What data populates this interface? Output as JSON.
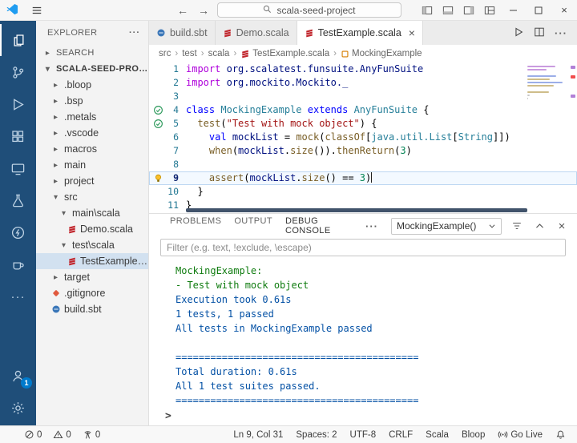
{
  "titlebar": {
    "search_value": "scala-seed-project"
  },
  "activitybar": {
    "account_badge": "1"
  },
  "sidebar": {
    "header": "EXPLORER",
    "tree": [
      {
        "label": "SEARCH",
        "depth": 0,
        "kind": "section",
        "expanded": false
      },
      {
        "label": "SCALA-SEED-PROJECT",
        "depth": 0,
        "kind": "section",
        "expanded": true,
        "bold": true
      },
      {
        "label": ".bloop",
        "depth": 1,
        "kind": "folder",
        "expanded": false
      },
      {
        "label": ".bsp",
        "depth": 1,
        "kind": "folder",
        "expanded": false
      },
      {
        "label": ".metals",
        "depth": 1,
        "kind": "folder",
        "expanded": false
      },
      {
        "label": ".vscode",
        "depth": 1,
        "kind": "folder",
        "expanded": false
      },
      {
        "label": "macros",
        "depth": 1,
        "kind": "folder",
        "expanded": false
      },
      {
        "label": "main",
        "depth": 1,
        "kind": "folder",
        "expanded": false
      },
      {
        "label": "project",
        "depth": 1,
        "kind": "folder",
        "expanded": false
      },
      {
        "label": "src",
        "depth": 1,
        "kind": "folder",
        "expanded": true
      },
      {
        "label": "main\\scala",
        "depth": 2,
        "kind": "folder",
        "expanded": true
      },
      {
        "label": "Demo.scala",
        "depth": 3,
        "kind": "file",
        "icon": "scala"
      },
      {
        "label": "test\\scala",
        "depth": 2,
        "kind": "folder",
        "expanded": true
      },
      {
        "label": "TestExample.scala",
        "depth": 3,
        "kind": "file",
        "icon": "scala",
        "selected": true
      },
      {
        "label": "target",
        "depth": 1,
        "kind": "folder",
        "expanded": false
      },
      {
        "label": ".gitignore",
        "depth": 1,
        "kind": "file",
        "icon": "git"
      },
      {
        "label": "build.sbt",
        "depth": 1,
        "kind": "file",
        "icon": "sbt"
      }
    ]
  },
  "editor_tabs": [
    {
      "label": "build.sbt",
      "icon": "sbt",
      "active": false
    },
    {
      "label": "Demo.scala",
      "icon": "scala",
      "active": false
    },
    {
      "label": "TestExample.scala",
      "icon": "scala",
      "active": true
    }
  ],
  "breadcrumbs": [
    {
      "label": "src"
    },
    {
      "label": "test"
    },
    {
      "label": "scala"
    },
    {
      "label": "TestExample.scala",
      "icon": "scala"
    },
    {
      "label": "MockingExample",
      "icon": "symbol-class"
    }
  ],
  "editor": {
    "lines": [
      {
        "num": "1",
        "gutter": "",
        "tokens": [
          {
            "t": "import",
            "c": "kw"
          },
          {
            "t": " ",
            "c": "pl"
          },
          {
            "t": "org.scalatest.funsuite.AnyFunSuite",
            "c": "ns_var",
            "_": ""
          },
          {
            "t": "",
            "c": "pl"
          }
        ]
      },
      {
        "num": "2",
        "gutter": "",
        "tokens": [
          {
            "t": "import",
            "c": "kw"
          },
          {
            "t": " ",
            "c": "pl"
          },
          {
            "t": "org.mockito.Mockito._",
            "c": "ns_var"
          }
        ]
      },
      {
        "num": "3",
        "gutter": "",
        "tokens": []
      },
      {
        "num": "4",
        "gutter": "pass",
        "tokens": [
          {
            "t": "class",
            "c": "kwb"
          },
          {
            "t": " ",
            "c": "pl"
          },
          {
            "t": "MockingExample",
            "c": "ty"
          },
          {
            "t": " ",
            "c": "pl"
          },
          {
            "t": "extends",
            "c": "kwb"
          },
          {
            "t": " ",
            "c": "pl"
          },
          {
            "t": "AnyFunSuite",
            "c": "ty"
          },
          {
            "t": " {",
            "c": "pl"
          }
        ]
      },
      {
        "num": "5",
        "gutter": "pass",
        "tokens": [
          {
            "t": "  ",
            "c": "pl"
          },
          {
            "t": "test",
            "c": "fn"
          },
          {
            "t": "(",
            "c": "pl"
          },
          {
            "t": "\"Test with mock object\"",
            "c": "str"
          },
          {
            "t": ") {",
            "c": "pl"
          }
        ]
      },
      {
        "num": "6",
        "gutter": "",
        "tokens": [
          {
            "t": "    ",
            "c": "pl"
          },
          {
            "t": "val",
            "c": "kwb"
          },
          {
            "t": " ",
            "c": "pl"
          },
          {
            "t": "mockList",
            "c": "var"
          },
          {
            "t": " = ",
            "c": "pl"
          },
          {
            "t": "mock",
            "c": "fn"
          },
          {
            "t": "(",
            "c": "pl"
          },
          {
            "t": "classOf",
            "c": "fn"
          },
          {
            "t": "[",
            "c": "pl"
          },
          {
            "t": "java.util.List",
            "c": "ty"
          },
          {
            "t": "[",
            "c": "pl"
          },
          {
            "t": "String",
            "c": "ty"
          },
          {
            "t": "]])",
            "c": "pl"
          }
        ]
      },
      {
        "num": "7",
        "gutter": "",
        "tokens": [
          {
            "t": "    ",
            "c": "pl"
          },
          {
            "t": "when",
            "c": "fn"
          },
          {
            "t": "(",
            "c": "pl"
          },
          {
            "t": "mockList",
            "c": "var"
          },
          {
            "t": ".",
            "c": "pl"
          },
          {
            "t": "size",
            "c": "fn"
          },
          {
            "t": "()).",
            "c": "pl"
          },
          {
            "t": "thenReturn",
            "c": "fn"
          },
          {
            "t": "(",
            "c": "pl"
          },
          {
            "t": "3",
            "c": "num"
          },
          {
            "t": ")",
            "c": "pl"
          }
        ]
      },
      {
        "num": "8",
        "gutter": "",
        "tokens": []
      },
      {
        "num": "9",
        "gutter": "bulb",
        "current": true,
        "tokens": [
          {
            "t": "    ",
            "c": "pl"
          },
          {
            "t": "assert",
            "c": "fn"
          },
          {
            "t": "(",
            "c": "pl"
          },
          {
            "t": "mockList",
            "c": "var"
          },
          {
            "t": ".",
            "c": "pl"
          },
          {
            "t": "size",
            "c": "fn"
          },
          {
            "t": "() == ",
            "c": "pl"
          },
          {
            "t": "3",
            "c": "num"
          },
          {
            "t": ")",
            "c": "pl"
          }
        ]
      },
      {
        "num": "10",
        "gutter": "",
        "tokens": [
          {
            "t": "  }",
            "c": "pl"
          }
        ]
      },
      {
        "num": "11",
        "gutter": "",
        "tokens": [
          {
            "t": "}",
            "c": "pl"
          }
        ]
      }
    ]
  },
  "panel": {
    "tabs": [
      {
        "label": "PROBLEMS",
        "active": false
      },
      {
        "label": "OUTPUT",
        "active": false
      },
      {
        "label": "DEBUG CONSOLE",
        "active": true
      }
    ],
    "session_dropdown": "MockingExample()",
    "filter_placeholder": "Filter (e.g. text, !exclude, \\escape)",
    "console_lines": [
      {
        "text": "MockingExample:",
        "color": "green"
      },
      {
        "text": "- Test with mock object",
        "color": "green"
      },
      {
        "text": "Execution took 0.61s",
        "color": "blue"
      },
      {
        "text": "1 tests, 1 passed",
        "color": "blue"
      },
      {
        "text": "All tests in MockingExample passed",
        "color": "blue"
      },
      {
        "text": "",
        "color": "blue"
      },
      {
        "text": "==========================================",
        "color": "blue"
      },
      {
        "text": "Total duration: 0.61s",
        "color": "blue"
      },
      {
        "text": "All 1 test suites passed.",
        "color": "blue"
      },
      {
        "text": "==========================================",
        "color": "blue"
      }
    ],
    "prompt": ">"
  },
  "statusbar": {
    "left": [
      {
        "icon": "error",
        "label": "0"
      },
      {
        "icon": "warning",
        "label": "0"
      },
      {
        "icon": "tower",
        "label": "0"
      }
    ],
    "right": [
      {
        "label": "Ln 9, Col 31"
      },
      {
        "label": "Spaces: 2"
      },
      {
        "label": "UTF-8"
      },
      {
        "label": "CRLF"
      },
      {
        "label": "Scala"
      },
      {
        "label": "Bloop"
      },
      {
        "icon": "broadcast",
        "label": "Go Live"
      },
      {
        "icon": "bell",
        "label": ""
      }
    ]
  },
  "colors": {
    "accent": "#007acc",
    "activitybar_bg": "#1f4e79",
    "console_green": "#107c10",
    "console_blue": "#0451a5",
    "panel_active_tab_border": "#a1260d"
  }
}
